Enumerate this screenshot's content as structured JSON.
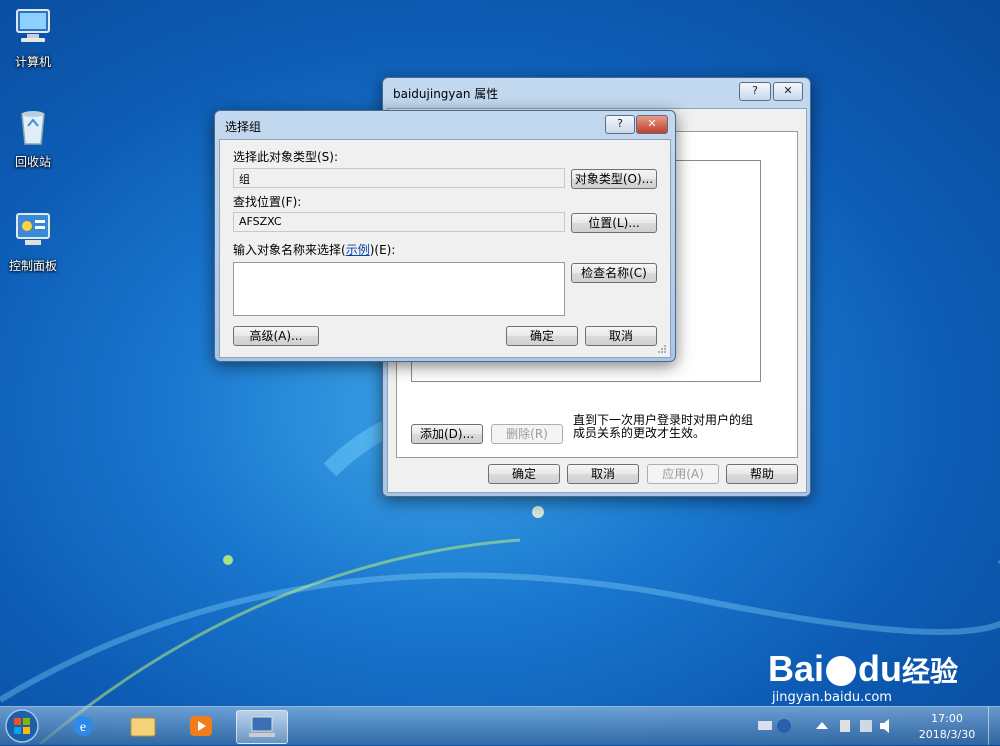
{
  "desktop": {
    "icons": [
      {
        "label": "计算机"
      },
      {
        "label": "回收站"
      },
      {
        "label": "控制面板"
      }
    ]
  },
  "properties_dialog": {
    "title": "baidujingyan 属性",
    "help_btn": "?",
    "close_btn": "✕",
    "add_button": "添加(D)...",
    "remove_button": "删除(R)",
    "note": "直到下一次用户登录时对用户的组成员关系的更改才生效。",
    "ok_button": "确定",
    "cancel_button": "取消",
    "apply_button": "应用(A)",
    "help_button": "帮助"
  },
  "select_group_dialog": {
    "title": "选择组",
    "help_btn": "?",
    "close_btn": "✕",
    "object_type_label": "选择此对象类型(S):",
    "object_type_value": "组",
    "object_types_button": "对象类型(O)...",
    "location_label": "查找位置(F):",
    "location_value": "AFSZXC",
    "locations_button": "位置(L)...",
    "enter_names_label_prefix": "输入对象名称来选择(",
    "enter_names_link": "示例",
    "enter_names_label_suffix": ")(E):",
    "check_names_button": "检查名称(C)",
    "advanced_button": "高级(A)...",
    "ok_button": "确定",
    "cancel_button": "取消"
  },
  "taskbar": {
    "items": [
      "start",
      "internet-explorer",
      "file-explorer",
      "media-player",
      "computer-management"
    ],
    "clock_time": "17:00",
    "clock_date": "2018/3/30"
  },
  "watermark": {
    "brand": "Bai",
    "brand2": "du",
    "suffix": "经验",
    "url": "jingyan.baidu.com"
  }
}
